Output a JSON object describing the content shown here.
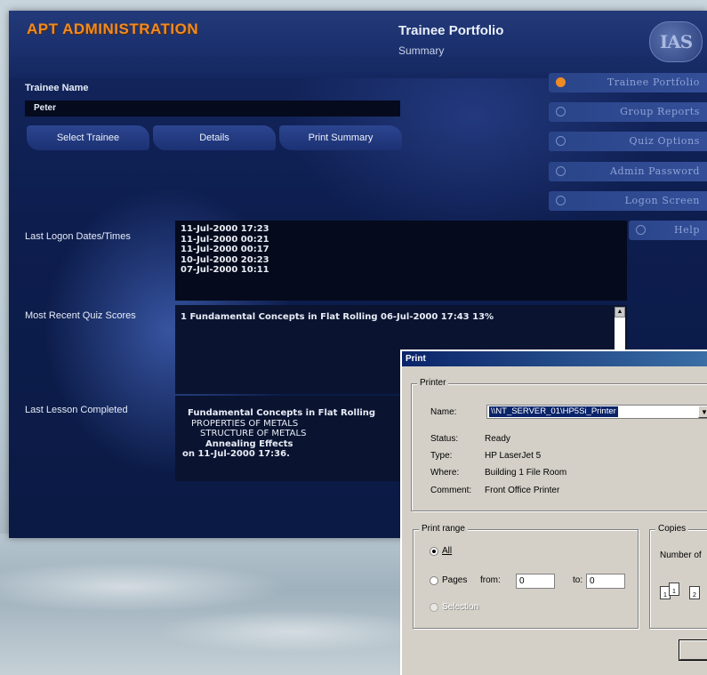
{
  "header": {
    "app_title": "APT ADMINISTRATION",
    "page_title": "Trainee Portfolio",
    "page_subtitle": "Summary",
    "logo_text": "IAS"
  },
  "trainee": {
    "label": "Trainee Name",
    "value": "Peter",
    "buttons": {
      "select": "Select Trainee",
      "details": "Details",
      "print": "Print Summary"
    }
  },
  "nav": {
    "items": [
      {
        "label": "Trainee Portfolio",
        "active": true
      },
      {
        "label": "Group Reports",
        "active": false
      },
      {
        "label": "Quiz Options",
        "active": false
      },
      {
        "label": "Admin Password",
        "active": false
      },
      {
        "label": "Logon Screen",
        "active": false
      },
      {
        "label": "Help",
        "active": false
      }
    ]
  },
  "logons": {
    "label": "Last Logon Dates/Times",
    "entries": [
      "11-Jul-2000 17:23",
      "11-Jul-2000 00:21",
      "11-Jul-2000 00:17",
      "10-Jul-2000 20:23",
      "07-Jul-2000 10:11"
    ]
  },
  "quiz": {
    "label": "Most Recent Quiz Scores",
    "entries": [
      "1 Fundamental Concepts in Flat Rolling 06-Jul-2000 17:43 13%"
    ]
  },
  "lesson": {
    "label": "Last Lesson Completed",
    "lines": [
      "Fundamental Concepts in Flat Rolling",
      "PROPERTIES OF METALS",
      "STRUCTURE OF METALS",
      "Annealing Effects",
      "on 11-Jul-2000 17:36."
    ]
  },
  "print_dialog": {
    "title": "Print",
    "printer_group": "Printer",
    "name_label": "Name:",
    "name_value": "\\\\NT_SERVER_01\\HP5Si_Printer",
    "status_label": "Status:",
    "status_value": "Ready",
    "type_label": "Type:",
    "type_value": "HP LaserJet 5",
    "where_label": "Where:",
    "where_value": "Building 1 File Room",
    "comment_label": "Comment:",
    "comment_value": "Front Office Printer",
    "range_group": "Print range",
    "all_label": "All",
    "pages_label": "Pages",
    "from_label": "from:",
    "from_value": "0",
    "to_label": "to:",
    "to_value": "0",
    "selection_label": "Selection",
    "copies_group": "Copies",
    "copies_label": "Number of"
  },
  "colors": {
    "accent": "#f08a24",
    "panel_dark": "#050a1c",
    "dialog_title": "#0a246a"
  }
}
